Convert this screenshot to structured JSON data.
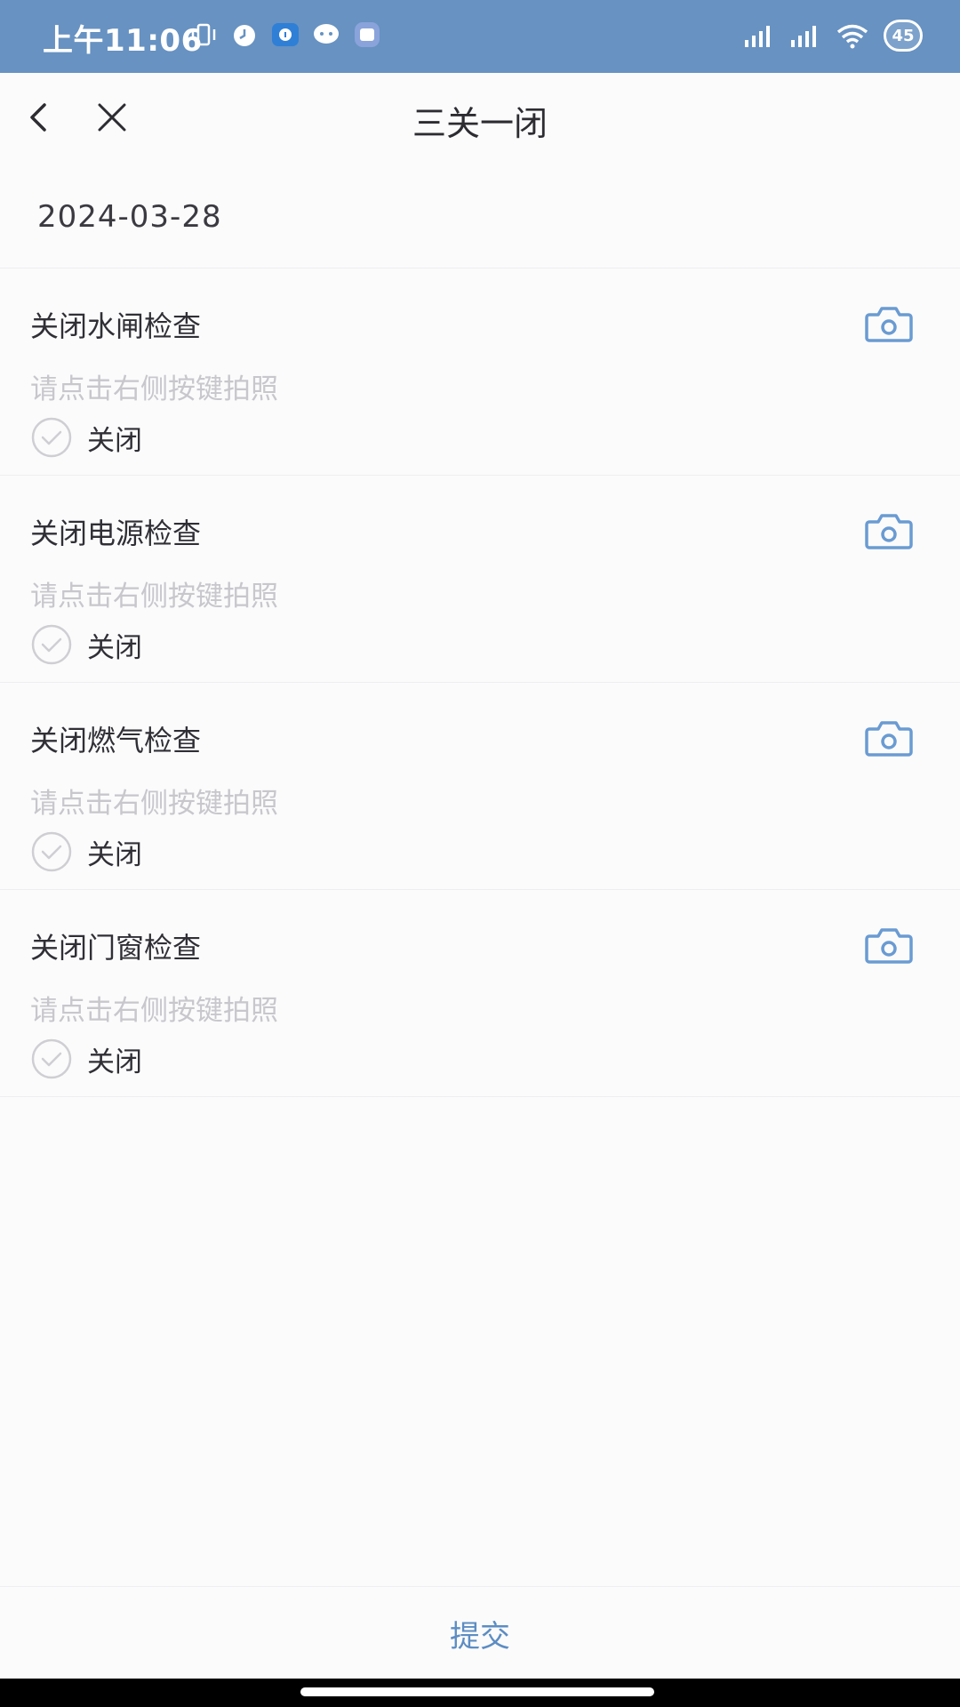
{
  "status_bar": {
    "time": "上午11:06",
    "battery": "45",
    "colors": {
      "background": "#6792c2"
    },
    "left_icons": [
      "vibrate-icon",
      "alarm-icon",
      "app-notification-icon",
      "chat-icon",
      "app-badge-icon"
    ],
    "right_icons": [
      "signal-icon",
      "signal-icon",
      "wifi-icon"
    ]
  },
  "nav": {
    "title": "三关一闭",
    "back_icon": "chevron-left-icon",
    "close_icon": "close-icon"
  },
  "date": "2024-03-28",
  "items": [
    {
      "title": "关闭水闸检查",
      "hint": "请点击右侧按键拍照",
      "check_label": "关闭",
      "checked": false
    },
    {
      "title": "关闭电源检查",
      "hint": "请点击右侧按键拍照",
      "check_label": "关闭",
      "checked": false
    },
    {
      "title": "关闭燃气检查",
      "hint": "请点击右侧按键拍照",
      "check_label": "关闭",
      "checked": false
    },
    {
      "title": "关闭门窗检查",
      "hint": "请点击右侧按键拍照",
      "check_label": "关闭",
      "checked": false
    }
  ],
  "footer": {
    "submit_label": "提交"
  },
  "colors": {
    "accent": "#5d8dc2",
    "camera": "#6a9bd2",
    "hint": "#c7c7cc"
  }
}
